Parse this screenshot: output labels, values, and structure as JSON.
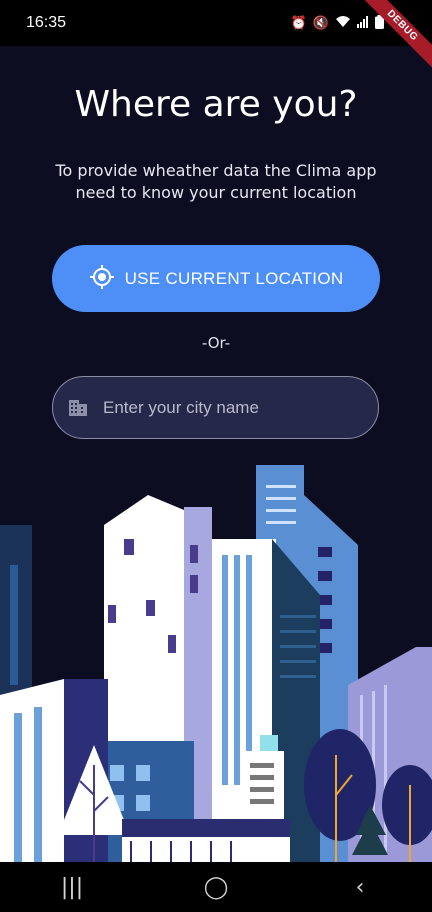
{
  "status_bar": {
    "time": "16:35",
    "icons": [
      "alarm-icon",
      "mute-icon",
      "wifi-icon",
      "signal-icon",
      "battery-icon"
    ]
  },
  "debug_banner": "DEBUG",
  "screen": {
    "title": "Where are you?",
    "subtitle": "To provide wheather data the Clima app need to know your current location",
    "location_button_label": "USE CURRENT LOCATION",
    "or_text": "-Or-",
    "city_input_placeholder": "Enter your city name",
    "city_input_value": ""
  },
  "colors": {
    "background": "#0c0d21",
    "button": "#4d8ff7",
    "input_bg": "#26284a"
  },
  "nav_bar": {
    "icons": [
      "recent-apps-icon",
      "home-icon",
      "back-icon"
    ]
  }
}
